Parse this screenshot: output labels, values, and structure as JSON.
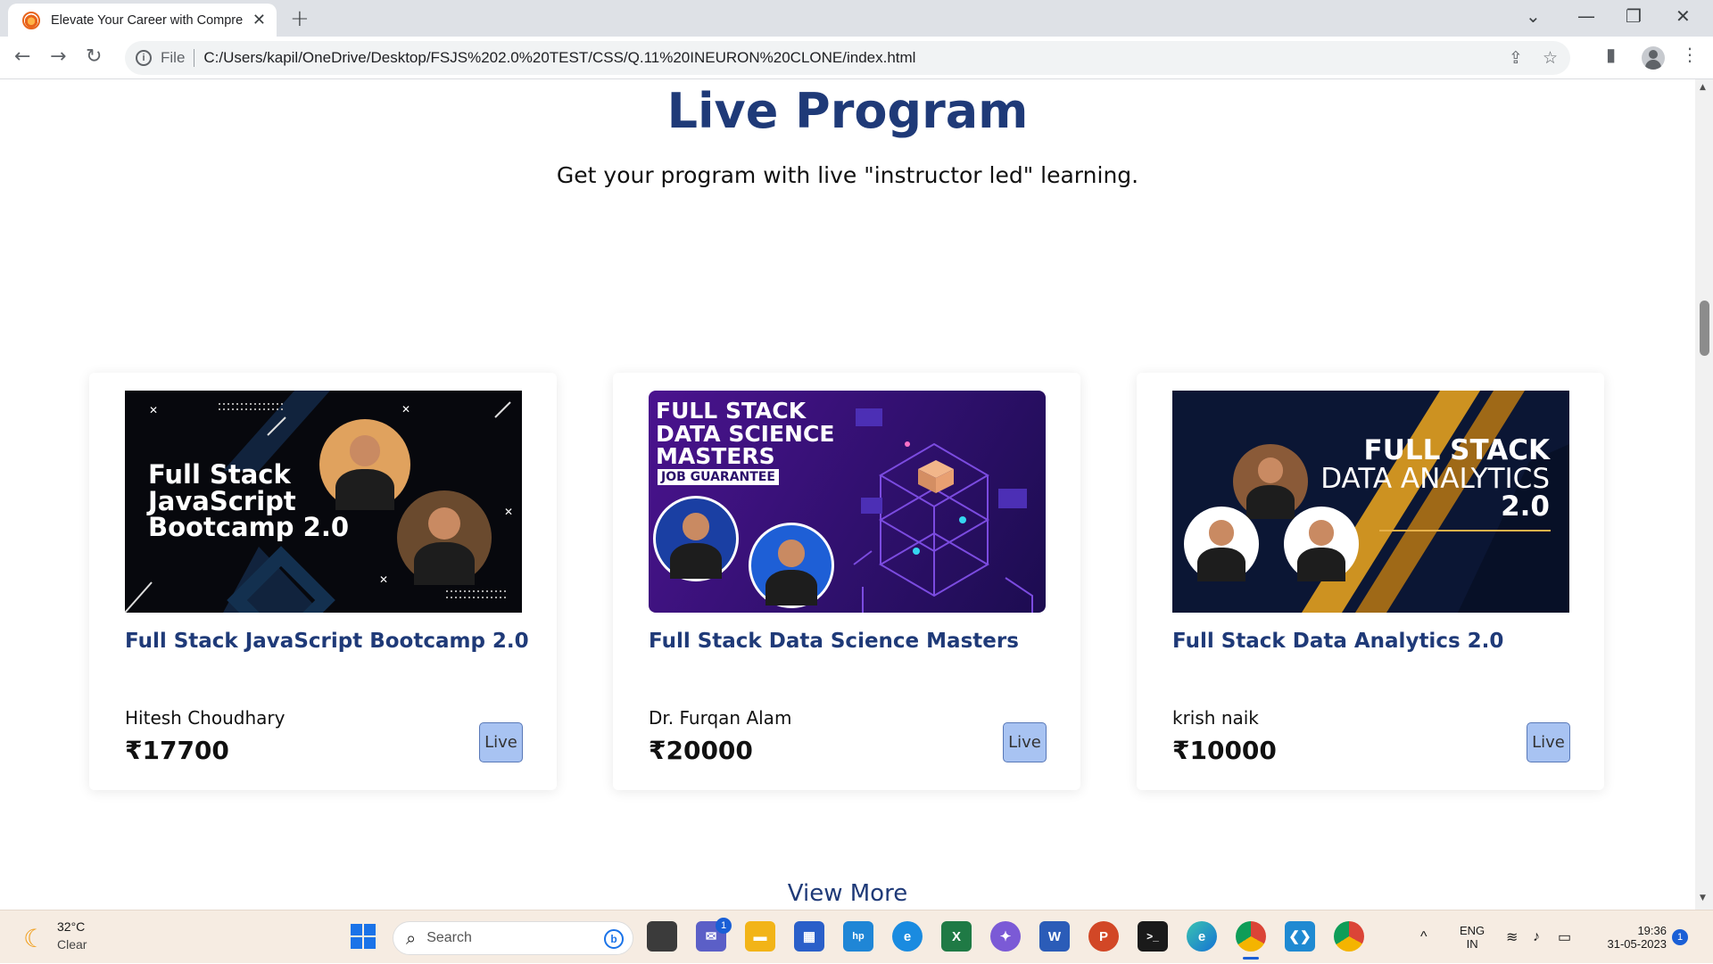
{
  "browser": {
    "tab_title": "Elevate Your Career with Compre",
    "new_tab_glyph": "+",
    "address_scheme": "File",
    "address_url": "C:/Users/kapil/OneDrive/Desktop/FSJS%202.0%20TEST/CSS/Q.11%20INEURON%20CLONE/index.html"
  },
  "section": {
    "title": "Live Program",
    "subtitle": "Get your program with live \"instructor led\" learning."
  },
  "courses": [
    {
      "banner_text": [
        "Full Stack",
        "JavaScript",
        "Bootcamp 2.0"
      ],
      "title": "Full Stack JavaScript Bootcamp 2.0",
      "instructor": "Hitesh Choudhary",
      "price": "₹17700",
      "badge": "Live"
    },
    {
      "banner_text": [
        "FULL STACK",
        "DATA SCIENCE",
        "MASTERS"
      ],
      "banner_tag": "JOB GUARANTEE",
      "title": "Full Stack Data Science Masters",
      "instructor": "Dr. Furqan Alam",
      "price": "₹20000",
      "badge": "Live"
    },
    {
      "banner_text": [
        "FULL STACK",
        "DATA ANALYTICS",
        "2.0"
      ],
      "title": "Full Stack Data Analytics 2.0",
      "instructor": "krish naik",
      "price": "₹10000",
      "badge": "Live"
    }
  ],
  "view_more": "View More",
  "taskbar": {
    "weather_temp": "32°C",
    "weather_desc": "Clear",
    "search_label": "Search",
    "lang_top": "ENG",
    "lang_bottom": "IN",
    "time": "19:36",
    "date": "31-05-2023",
    "notification_count": "1",
    "teams_badge": "1"
  },
  "colors": {
    "heading": "#1f3a78",
    "live_badge_bg": "#a8c3f2",
    "taskbar_bg": "#f6ece2"
  }
}
